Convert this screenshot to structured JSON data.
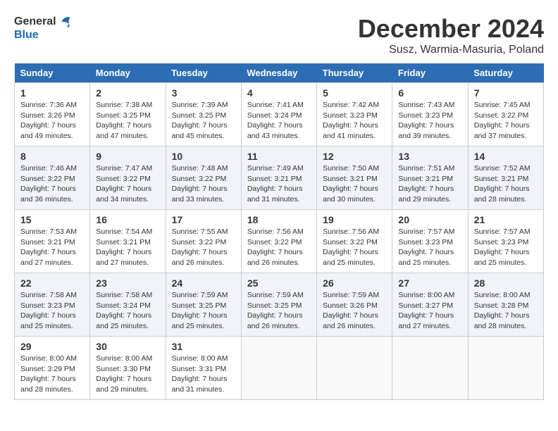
{
  "header": {
    "logo_line1": "General",
    "logo_line2": "Blue",
    "main_title": "December 2024",
    "sub_title": "Susz, Warmia-Masuria, Poland"
  },
  "days_of_week": [
    "Sunday",
    "Monday",
    "Tuesday",
    "Wednesday",
    "Thursday",
    "Friday",
    "Saturday"
  ],
  "weeks": [
    [
      {
        "day": "1",
        "info": "Sunrise: 7:36 AM\nSunset: 3:26 PM\nDaylight: 7 hours\nand 49 minutes."
      },
      {
        "day": "2",
        "info": "Sunrise: 7:38 AM\nSunset: 3:25 PM\nDaylight: 7 hours\nand 47 minutes."
      },
      {
        "day": "3",
        "info": "Sunrise: 7:39 AM\nSunset: 3:25 PM\nDaylight: 7 hours\nand 45 minutes."
      },
      {
        "day": "4",
        "info": "Sunrise: 7:41 AM\nSunset: 3:24 PM\nDaylight: 7 hours\nand 43 minutes."
      },
      {
        "day": "5",
        "info": "Sunrise: 7:42 AM\nSunset: 3:23 PM\nDaylight: 7 hours\nand 41 minutes."
      },
      {
        "day": "6",
        "info": "Sunrise: 7:43 AM\nSunset: 3:23 PM\nDaylight: 7 hours\nand 39 minutes."
      },
      {
        "day": "7",
        "info": "Sunrise: 7:45 AM\nSunset: 3:22 PM\nDaylight: 7 hours\nand 37 minutes."
      }
    ],
    [
      {
        "day": "8",
        "info": "Sunrise: 7:46 AM\nSunset: 3:22 PM\nDaylight: 7 hours\nand 36 minutes."
      },
      {
        "day": "9",
        "info": "Sunrise: 7:47 AM\nSunset: 3:22 PM\nDaylight: 7 hours\nand 34 minutes."
      },
      {
        "day": "10",
        "info": "Sunrise: 7:48 AM\nSunset: 3:22 PM\nDaylight: 7 hours\nand 33 minutes."
      },
      {
        "day": "11",
        "info": "Sunrise: 7:49 AM\nSunset: 3:21 PM\nDaylight: 7 hours\nand 31 minutes."
      },
      {
        "day": "12",
        "info": "Sunrise: 7:50 AM\nSunset: 3:21 PM\nDaylight: 7 hours\nand 30 minutes."
      },
      {
        "day": "13",
        "info": "Sunrise: 7:51 AM\nSunset: 3:21 PM\nDaylight: 7 hours\nand 29 minutes."
      },
      {
        "day": "14",
        "info": "Sunrise: 7:52 AM\nSunset: 3:21 PM\nDaylight: 7 hours\nand 28 minutes."
      }
    ],
    [
      {
        "day": "15",
        "info": "Sunrise: 7:53 AM\nSunset: 3:21 PM\nDaylight: 7 hours\nand 27 minutes."
      },
      {
        "day": "16",
        "info": "Sunrise: 7:54 AM\nSunset: 3:21 PM\nDaylight: 7 hours\nand 27 minutes."
      },
      {
        "day": "17",
        "info": "Sunrise: 7:55 AM\nSunset: 3:22 PM\nDaylight: 7 hours\nand 26 minutes."
      },
      {
        "day": "18",
        "info": "Sunrise: 7:56 AM\nSunset: 3:22 PM\nDaylight: 7 hours\nand 26 minutes."
      },
      {
        "day": "19",
        "info": "Sunrise: 7:56 AM\nSunset: 3:22 PM\nDaylight: 7 hours\nand 25 minutes."
      },
      {
        "day": "20",
        "info": "Sunrise: 7:57 AM\nSunset: 3:23 PM\nDaylight: 7 hours\nand 25 minutes."
      },
      {
        "day": "21",
        "info": "Sunrise: 7:57 AM\nSunset: 3:23 PM\nDaylight: 7 hours\nand 25 minutes."
      }
    ],
    [
      {
        "day": "22",
        "info": "Sunrise: 7:58 AM\nSunset: 3:23 PM\nDaylight: 7 hours\nand 25 minutes."
      },
      {
        "day": "23",
        "info": "Sunrise: 7:58 AM\nSunset: 3:24 PM\nDaylight: 7 hours\nand 25 minutes."
      },
      {
        "day": "24",
        "info": "Sunrise: 7:59 AM\nSunset: 3:25 PM\nDaylight: 7 hours\nand 25 minutes."
      },
      {
        "day": "25",
        "info": "Sunrise: 7:59 AM\nSunset: 3:25 PM\nDaylight: 7 hours\nand 26 minutes."
      },
      {
        "day": "26",
        "info": "Sunrise: 7:59 AM\nSunset: 3:26 PM\nDaylight: 7 hours\nand 26 minutes."
      },
      {
        "day": "27",
        "info": "Sunrise: 8:00 AM\nSunset: 3:27 PM\nDaylight: 7 hours\nand 27 minutes."
      },
      {
        "day": "28",
        "info": "Sunrise: 8:00 AM\nSunset: 3:28 PM\nDaylight: 7 hours\nand 28 minutes."
      }
    ],
    [
      {
        "day": "29",
        "info": "Sunrise: 8:00 AM\nSunset: 3:29 PM\nDaylight: 7 hours\nand 28 minutes."
      },
      {
        "day": "30",
        "info": "Sunrise: 8:00 AM\nSunset: 3:30 PM\nDaylight: 7 hours\nand 29 minutes."
      },
      {
        "day": "31",
        "info": "Sunrise: 8:00 AM\nSunset: 3:31 PM\nDaylight: 7 hours\nand 31 minutes."
      },
      {
        "day": "",
        "info": ""
      },
      {
        "day": "",
        "info": ""
      },
      {
        "day": "",
        "info": ""
      },
      {
        "day": "",
        "info": ""
      }
    ]
  ]
}
